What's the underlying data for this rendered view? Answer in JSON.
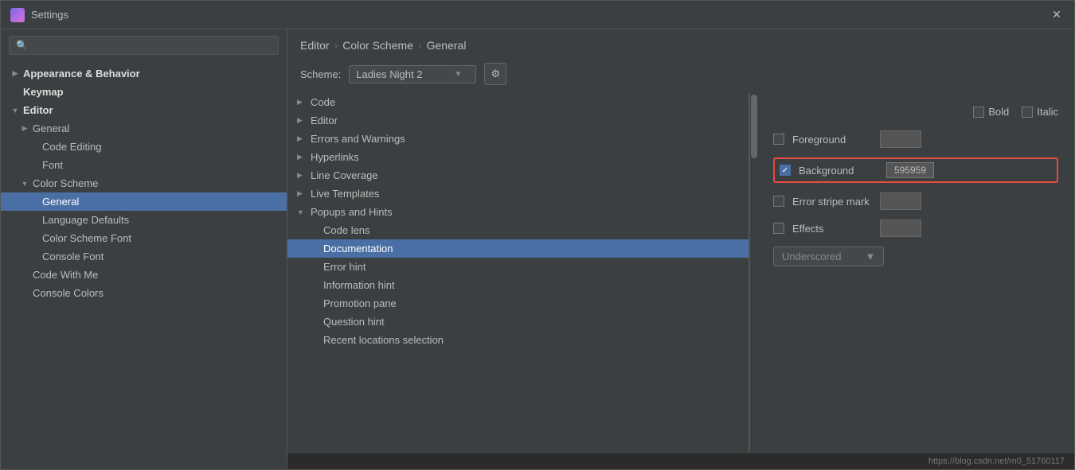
{
  "window": {
    "title": "Settings",
    "close_label": "✕"
  },
  "search": {
    "placeholder": "🔍"
  },
  "sidebar": {
    "items": [
      {
        "id": "appearance",
        "label": "Appearance & Behavior",
        "indent": 0,
        "bold": true,
        "chevron": "▶",
        "selected": false
      },
      {
        "id": "keymap",
        "label": "Keymap",
        "indent": 0,
        "bold": true,
        "chevron": "",
        "selected": false
      },
      {
        "id": "editor",
        "label": "Editor",
        "indent": 0,
        "bold": true,
        "chevron": "▼",
        "selected": false
      },
      {
        "id": "general",
        "label": "General",
        "indent": 1,
        "bold": false,
        "chevron": "▶",
        "selected": false
      },
      {
        "id": "code-editing",
        "label": "Code Editing",
        "indent": 2,
        "bold": false,
        "chevron": "",
        "selected": false
      },
      {
        "id": "font",
        "label": "Font",
        "indent": 2,
        "bold": false,
        "chevron": "",
        "selected": false
      },
      {
        "id": "color-scheme",
        "label": "Color Scheme",
        "indent": 1,
        "bold": false,
        "chevron": "▼",
        "selected": false
      },
      {
        "id": "general-selected",
        "label": "General",
        "indent": 2,
        "bold": false,
        "chevron": "",
        "selected": true
      },
      {
        "id": "language-defaults",
        "label": "Language Defaults",
        "indent": 2,
        "bold": false,
        "chevron": "",
        "selected": false
      },
      {
        "id": "color-scheme-font",
        "label": "Color Scheme Font",
        "indent": 2,
        "bold": false,
        "chevron": "",
        "selected": false
      },
      {
        "id": "console-font",
        "label": "Console Font",
        "indent": 2,
        "bold": false,
        "chevron": "",
        "selected": false
      },
      {
        "id": "code-with-me",
        "label": "Code With Me",
        "indent": 1,
        "bold": false,
        "chevron": "",
        "selected": false
      },
      {
        "id": "console-colors",
        "label": "Console Colors",
        "indent": 1,
        "bold": false,
        "chevron": "",
        "selected": false
      }
    ]
  },
  "breadcrumb": {
    "parts": [
      "Editor",
      "Color Scheme",
      "General"
    ]
  },
  "scheme": {
    "label": "Scheme:",
    "value": "Ladies Night 2",
    "gear_icon": "⚙"
  },
  "scheme_tree": {
    "items": [
      {
        "id": "code",
        "label": "Code",
        "indent": 0,
        "chevron": "▶",
        "selected": false
      },
      {
        "id": "editor",
        "label": "Editor",
        "indent": 0,
        "chevron": "▶",
        "selected": false
      },
      {
        "id": "errors-warnings",
        "label": "Errors and Warnings",
        "indent": 0,
        "chevron": "▶",
        "selected": false
      },
      {
        "id": "hyperlinks",
        "label": "Hyperlinks",
        "indent": 0,
        "chevron": "▶",
        "selected": false
      },
      {
        "id": "line-coverage",
        "label": "Line Coverage",
        "indent": 0,
        "chevron": "▶",
        "selected": false
      },
      {
        "id": "live-templates",
        "label": "Live Templates",
        "indent": 0,
        "chevron": "▶",
        "selected": false
      },
      {
        "id": "popups-hints",
        "label": "Popups and Hints",
        "indent": 0,
        "chevron": "▼",
        "selected": false
      },
      {
        "id": "code-lens",
        "label": "Code lens",
        "indent": 1,
        "chevron": "",
        "selected": false
      },
      {
        "id": "documentation",
        "label": "Documentation",
        "indent": 1,
        "chevron": "",
        "selected": true
      },
      {
        "id": "error-hint",
        "label": "Error hint",
        "indent": 1,
        "chevron": "",
        "selected": false
      },
      {
        "id": "information-hint",
        "label": "Information hint",
        "indent": 1,
        "chevron": "",
        "selected": false
      },
      {
        "id": "promotion-pane",
        "label": "Promotion pane",
        "indent": 1,
        "chevron": "",
        "selected": false
      },
      {
        "id": "question-hint",
        "label": "Question hint",
        "indent": 1,
        "chevron": "",
        "selected": false
      },
      {
        "id": "recent-locations",
        "label": "Recent locations selection",
        "indent": 1,
        "chevron": "",
        "selected": false
      }
    ]
  },
  "properties": {
    "bold_label": "Bold",
    "italic_label": "Italic",
    "foreground_label": "Foreground",
    "background_label": "Background",
    "background_value": "595959",
    "error_stripe_label": "Error stripe mark",
    "effects_label": "Effects",
    "underscored_label": "Underscored",
    "foreground_checked": false,
    "background_checked": true,
    "error_stripe_checked": false,
    "effects_checked": false,
    "bold_checked": false,
    "italic_checked": false
  },
  "url": "https://blog.csdn.net/m0_51760117"
}
